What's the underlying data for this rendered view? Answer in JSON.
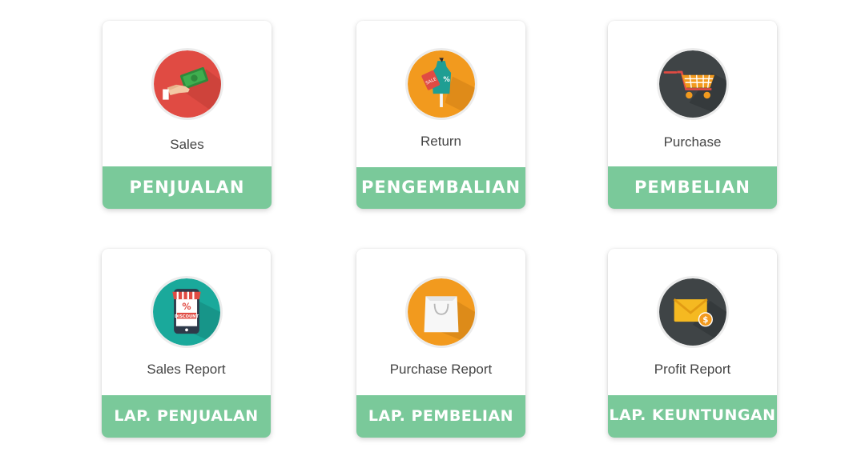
{
  "colors": {
    "footer": "#7ac99a",
    "sales_icon": "#e04b43",
    "return_icon": "#f29a1e",
    "purchase_icon": "#3f4446",
    "sales_report_icon": "#1aa99b",
    "purchase_report_icon": "#f29a1e",
    "profit_report_icon": "#3f4446"
  },
  "menu": [
    {
      "caption": "Sales",
      "label": "PENJUALAN",
      "icon": "money-hand-icon"
    },
    {
      "caption": "Return",
      "label": "PENGEMBALIAN",
      "icon": "sale-dress-icon"
    },
    {
      "caption": "Purchase",
      "label": "PEMBELIAN",
      "icon": "shopping-cart-icon"
    },
    {
      "caption": "Sales Report",
      "label": "LAP. PENJUALAN",
      "icon": "discount-phone-icon"
    },
    {
      "caption": "Purchase Report",
      "label": "LAP. PEMBELIAN",
      "icon": "shopping-bag-icon"
    },
    {
      "caption": "Profit Report",
      "label": "LAP. KEUNTUNGAN",
      "icon": "envelope-coin-icon"
    }
  ],
  "icon_text": {
    "sale_tag": "SALE",
    "percent": "%",
    "discount": "DISCOUNT",
    "dollar": "$"
  }
}
